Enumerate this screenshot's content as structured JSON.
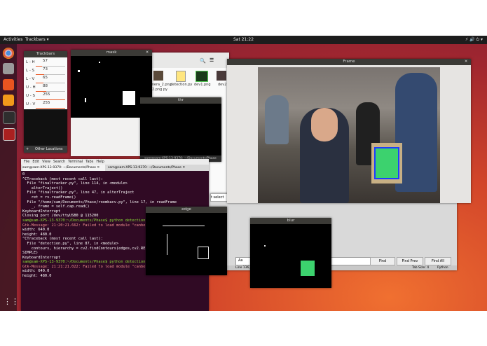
{
  "topbar": {
    "activities": "Activities",
    "app_menu": "Trackbars ▾",
    "clock": "Sat 21:22",
    "system_icons": "⚡ 🔊 ⏻ ▾"
  },
  "dock": {
    "icons": [
      "chromium-icon",
      "files-icon",
      "software-icon",
      "sublime-icon",
      "terminal-icon",
      "show-apps-icon"
    ],
    "colors": [
      "#4a8fe0",
      "#9a9a9a",
      "#e95420",
      "#f29a1a",
      "#2e2e2e",
      "#aa2020"
    ]
  },
  "trackbars": {
    "title": "Trackbars",
    "rows": [
      {
        "key": "L - H",
        "value": "57",
        "fraction": 0.22
      },
      {
        "key": "L - S",
        "value": "73",
        "fraction": 0.29
      },
      {
        "key": "L - V",
        "value": "65",
        "fraction": 0.25
      },
      {
        "key": "U - H",
        "value": "88",
        "fraction": 0.35
      },
      {
        "key": "U - S",
        "value": "255",
        "fraction": 1.0
      },
      {
        "key": "U - V",
        "value": "255",
        "fraction": 1.0
      }
    ],
    "other_locations": "Other Locations",
    "plus": "+"
  },
  "mask": {
    "title": "mask"
  },
  "thr": {
    "title": "thr"
  },
  "edge": {
    "title": "edge"
  },
  "blur": {
    "title": "blur"
  },
  "frame": {
    "title": "Frame"
  },
  "files": {
    "items": [
      "mera_2.png",
      "detection.py",
      "dev1.png",
      "dev2"
    ],
    "extra": "2.png  py"
  },
  "terminal": {
    "title": "sam@sam-XPS-13-9370: ~/Documents/Phase",
    "menu": [
      "File",
      "Edit",
      "View",
      "Search",
      "Terminal",
      "Tabs",
      "Help"
    ],
    "tabs": [
      "sam@sam-XPS-13-9370: ~/Documents/Phase",
      "sam@sam-XPS-13-9370: ~/Documents/Phase"
    ],
    "lines": [
      "0",
      "^CTraceback (most recent call last):",
      "  File \"finaltracker.py\", line 114, in <module>",
      "    alterTraject()",
      "  File \"finaltracker.py\", line 47, in alterTraject",
      "    ret = rv.readFrame()",
      "  File \"/home/sam/Documents/Phase/roombacv.py\", line 17, in readFrame",
      "    _, frame = self.cap.read()",
      "KeyboardInterrupt",
      "Closing port /dev/ttyUSB0 @ 115200",
      "sam@sam-XPS-13-9370:~/Documents/Phase$ python detection",
      "Gtk-Message: 21:20:21.662: Failed to load module \"canbe",
      "width: 640.0",
      "height: 480.0",
      "^CTraceback (most recent call last):",
      "  File \"detection.py\", line 87, in <module>",
      "    contours, hierarchy = cv2.findContours(edges,cv2.RE",
      "SIMPLE)",
      "KeyboardInterrupt",
      "sam@sam-XPS-13-9370:~/Documents/Phase$ python detection",
      "Gtk-Message: 21:21:21.022: Failed to load module \"canbe",
      "width: 640.0",
      "height: 480.0"
    ]
  },
  "editor": {
    "find": "Find",
    "find_prev": "Find Prev",
    "find_all": "Find All",
    "aa": "Aa",
    "status_line": "Line 136, C",
    "tab_size": "Tab Size: 4",
    "lang": "Python",
    "select": "t select"
  }
}
